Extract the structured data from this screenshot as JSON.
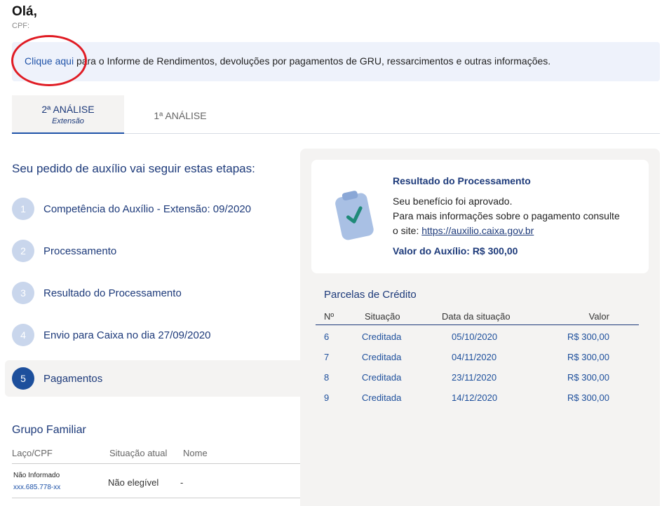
{
  "header": {
    "greeting": "Olá,",
    "cpf_label": "CPF:"
  },
  "banner": {
    "link_text": "Clique aqui",
    "text": " para o Informe de Rendimentos, devoluções por pagamentos de GRU, ressarcimentos e outras informações."
  },
  "tabs": [
    {
      "label": "2ª ANÁLISE",
      "sub": "Extensão",
      "active": true
    },
    {
      "label": "1ª ANÁLISE",
      "active": false
    }
  ],
  "steps": {
    "title": "Seu pedido de auxílio vai seguir estas etapas:",
    "items": [
      {
        "num": "1",
        "label": "Competência do Auxílio - Extensão: 09/2020"
      },
      {
        "num": "2",
        "label": "Processamento"
      },
      {
        "num": "3",
        "label": "Resultado do Processamento"
      },
      {
        "num": "4",
        "label": "Envio para Caixa no dia 27/09/2020"
      },
      {
        "num": "5",
        "label": "Pagamentos",
        "active": true
      }
    ]
  },
  "result": {
    "title": "Resultado do Processamento",
    "line1": "Seu benefício foi aprovado.",
    "line2": "Para mais informações sobre o pagamento consulte",
    "line3_prefix": "o site: ",
    "link": "https://auxilio.caixa.gov.br",
    "value_label": "Valor do Auxílio: R$ 300,00",
    "icon": "clipboard-check-icon"
  },
  "parcelas": {
    "title": "Parcelas de Crédito",
    "columns": [
      "Nº",
      "Situação",
      "Data da situação",
      "Valor"
    ],
    "rows": [
      {
        "n": "6",
        "situacao": "Creditada",
        "data": "05/10/2020",
        "valor": "R$ 300,00"
      },
      {
        "n": "7",
        "situacao": "Creditada",
        "data": "04/11/2020",
        "valor": "R$ 300,00"
      },
      {
        "n": "8",
        "situacao": "Creditada",
        "data": "23/11/2020",
        "valor": "R$ 300,00"
      },
      {
        "n": "9",
        "situacao": "Creditada",
        "data": "14/12/2020",
        "valor": "R$ 300,00"
      }
    ]
  },
  "familia": {
    "title": "Grupo Familiar",
    "columns": [
      "Laço/CPF",
      "Situação atual",
      "Nome"
    ],
    "rows": [
      {
        "laco": "Não Informado",
        "cpf": "xxx.685.778-xx",
        "situacao": "Não elegível",
        "nome": "-"
      }
    ]
  },
  "colors": {
    "primary": "#1d3a7a",
    "accent": "#1e52a8",
    "panel": "#f4f3f2",
    "annotation": "#e01c24"
  }
}
